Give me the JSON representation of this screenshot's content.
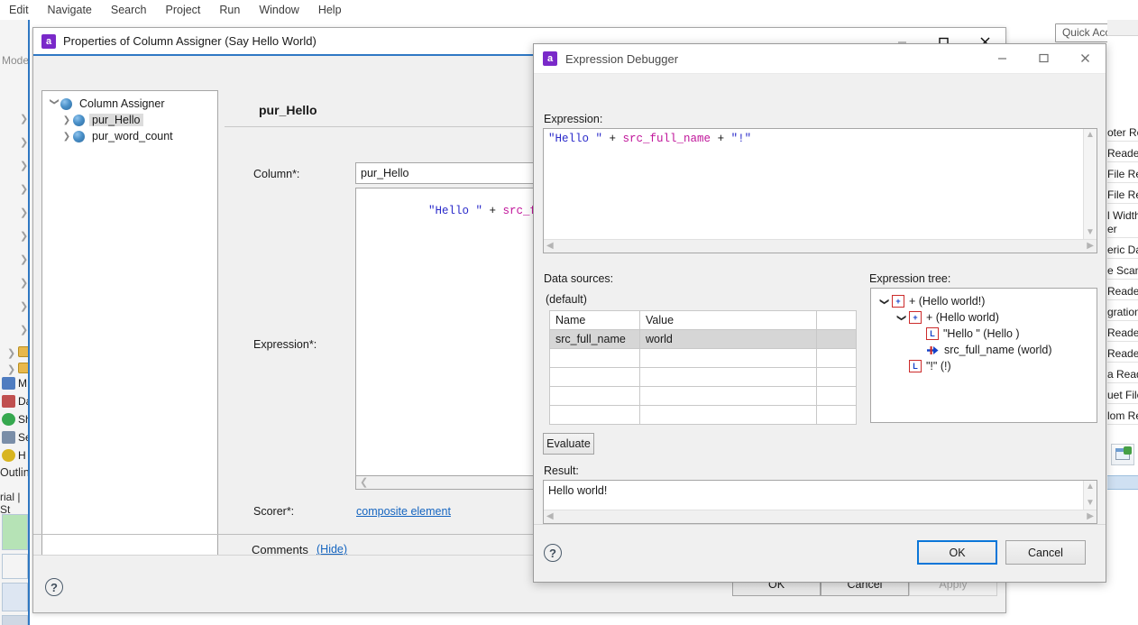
{
  "ide": {
    "menu": [
      "Edit",
      "Navigate",
      "Search",
      "Project",
      "Run",
      "Window",
      "Help"
    ],
    "quick_access": "Quick Access",
    "left_rail": {
      "tab_label": "Mode",
      "nodes": [
        {
          "label": "M",
          "color": "#4f7cc0"
        },
        {
          "label": "Da",
          "color": "#c0504f"
        },
        {
          "label": "Sh",
          "color": "#36a84f"
        },
        {
          "label": "Se",
          "color": "#7a8ea8"
        },
        {
          "label": "H",
          "color": "#d8b520"
        }
      ],
      "outline_label": "Outlin",
      "tabs2_label": "rial | St"
    },
    "right_rail": {
      "items": [
        "oter Rea",
        "Reade",
        "File Rea",
        "File Re",
        "l Width",
        "er",
        "eric Dat",
        "e Scan",
        "Reader",
        "gration",
        "Reader",
        "Reader",
        "a Reade",
        "uet File",
        "lom Re"
      ]
    }
  },
  "properties_dialog": {
    "title": "Properties of Column Assigner (Say Hello World)",
    "app_badge": "a",
    "window_buttons": [
      "minimize",
      "maximize",
      "close"
    ],
    "tree": [
      {
        "label": "Column Assigner",
        "depth": 0,
        "twisty": "down",
        "selected": false
      },
      {
        "label": "pur_Hello",
        "depth": 1,
        "twisty": "right",
        "selected": true
      },
      {
        "label": "pur_word_count",
        "depth": 1,
        "twisty": "right",
        "selected": false
      }
    ],
    "pane_heading": "pur_Hello",
    "column_label": "Column*:",
    "column_value": "pur_Hello",
    "expression_label": "Expression*:",
    "expression_tokens": [
      {
        "t": "\"Hello \"",
        "k": "str"
      },
      {
        "t": " + ",
        "k": "op"
      },
      {
        "t": "src_full_name",
        "k": "var"
      },
      {
        "t": " + ",
        "k": "op"
      },
      {
        "t": "\"!\"",
        "k": "str"
      }
    ],
    "scorer_label": "Scorer*:",
    "scorer_value": "composite element",
    "comments_label": "Comments",
    "comments_toggle": "(Hide)",
    "comments_value": "",
    "help_glyph": "?",
    "buttons": [
      {
        "label": "OK",
        "disabled": false
      },
      {
        "label": "Cancel",
        "disabled": false
      },
      {
        "label": "Apply",
        "disabled": true
      }
    ]
  },
  "expression_debugger": {
    "title": "Expression Debugger",
    "app_badge": "a",
    "window_buttons": [
      "minimize",
      "maximize",
      "close"
    ],
    "expression_label": "Expression:",
    "expression_tokens": [
      {
        "t": "\"Hello \"",
        "k": "str"
      },
      {
        "t": " + ",
        "k": "op"
      },
      {
        "t": "src_full_name",
        "k": "var"
      },
      {
        "t": " + ",
        "k": "op"
      },
      {
        "t": "\"!\"",
        "k": "str"
      }
    ],
    "data_sources_label": "Data sources:",
    "data_sources_scope": "(default)",
    "table": {
      "headers": [
        "Name",
        "Value",
        ""
      ],
      "rows": [
        {
          "cells": [
            "src_full_name",
            "world",
            ""
          ],
          "selected": true
        },
        {
          "cells": [
            "",
            "",
            ""
          ],
          "selected": false
        },
        {
          "cells": [
            "",
            "",
            ""
          ],
          "selected": false
        },
        {
          "cells": [
            "",
            "",
            ""
          ],
          "selected": false
        },
        {
          "cells": [
            "",
            "",
            ""
          ],
          "selected": false
        }
      ]
    },
    "expression_tree_label": "Expression tree:",
    "expression_tree": [
      {
        "depth": 0,
        "twisty": "down",
        "icon": "plus-box",
        "icon_text": "+",
        "label": "+ (Hello world!)"
      },
      {
        "depth": 1,
        "twisty": "down",
        "icon": "plus-box",
        "icon_text": "+",
        "label": "+ (Hello world)"
      },
      {
        "depth": 2,
        "twisty": "none",
        "icon": "literal-box",
        "icon_text": "L",
        "label": "\"Hello \" (Hello )"
      },
      {
        "depth": 2,
        "twisty": "none",
        "icon": "flow-arrow",
        "icon_text": "",
        "label": "src_full_name (world)"
      },
      {
        "depth": 1,
        "twisty": "none",
        "icon": "literal-box",
        "icon_text": "L",
        "label": "\"!\" (!)"
      }
    ],
    "evaluate_label": "Evaluate",
    "result_label": "Result:",
    "result_value": "Hello world!",
    "help_glyph": "?",
    "buttons": [
      {
        "label": "OK",
        "focused": true
      },
      {
        "label": "Cancel",
        "focused": false
      }
    ]
  },
  "colors": {
    "accent_blue": "#2f78c4",
    "focus_blue": "#0a76d8",
    "string_token": "#2a2aca",
    "var_token": "#c0159a",
    "link": "#1565c0",
    "app_badge": "#7a29c9",
    "icon_box_border": "#cc2b2b"
  }
}
